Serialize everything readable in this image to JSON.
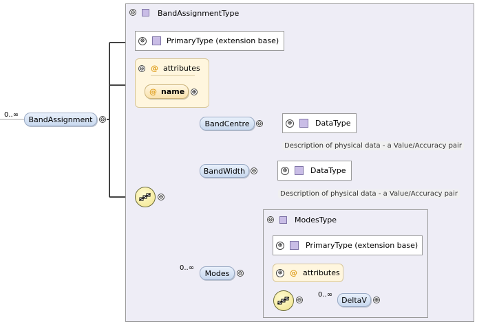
{
  "root": {
    "occurs": "0..∞",
    "name": "BandAssignment"
  },
  "type": {
    "name": "BandAssignmentType"
  },
  "primary_type": "PrimaryType (extension base)",
  "attributes": {
    "title": "attributes",
    "items": [
      "name"
    ]
  },
  "sequence": {
    "children": [
      {
        "name": "BandCentre",
        "type": "DataType",
        "description": "Description of physical data - a Value/Accuracy pair"
      },
      {
        "name": "BandWidth",
        "type": "DataType",
        "description": "Description of physical data - a Value/Accuracy pair"
      },
      {
        "name": "Modes",
        "occurs": "0..∞"
      }
    ]
  },
  "modes_type": {
    "name": "ModesType",
    "primary_type": "PrimaryType (extension base)",
    "attributes": "attributes",
    "child": {
      "name": "DeltaV",
      "occurs": "0..∞"
    }
  },
  "icons": {
    "expand": "⊕",
    "collapse": "⊖",
    "attribute": "@"
  }
}
